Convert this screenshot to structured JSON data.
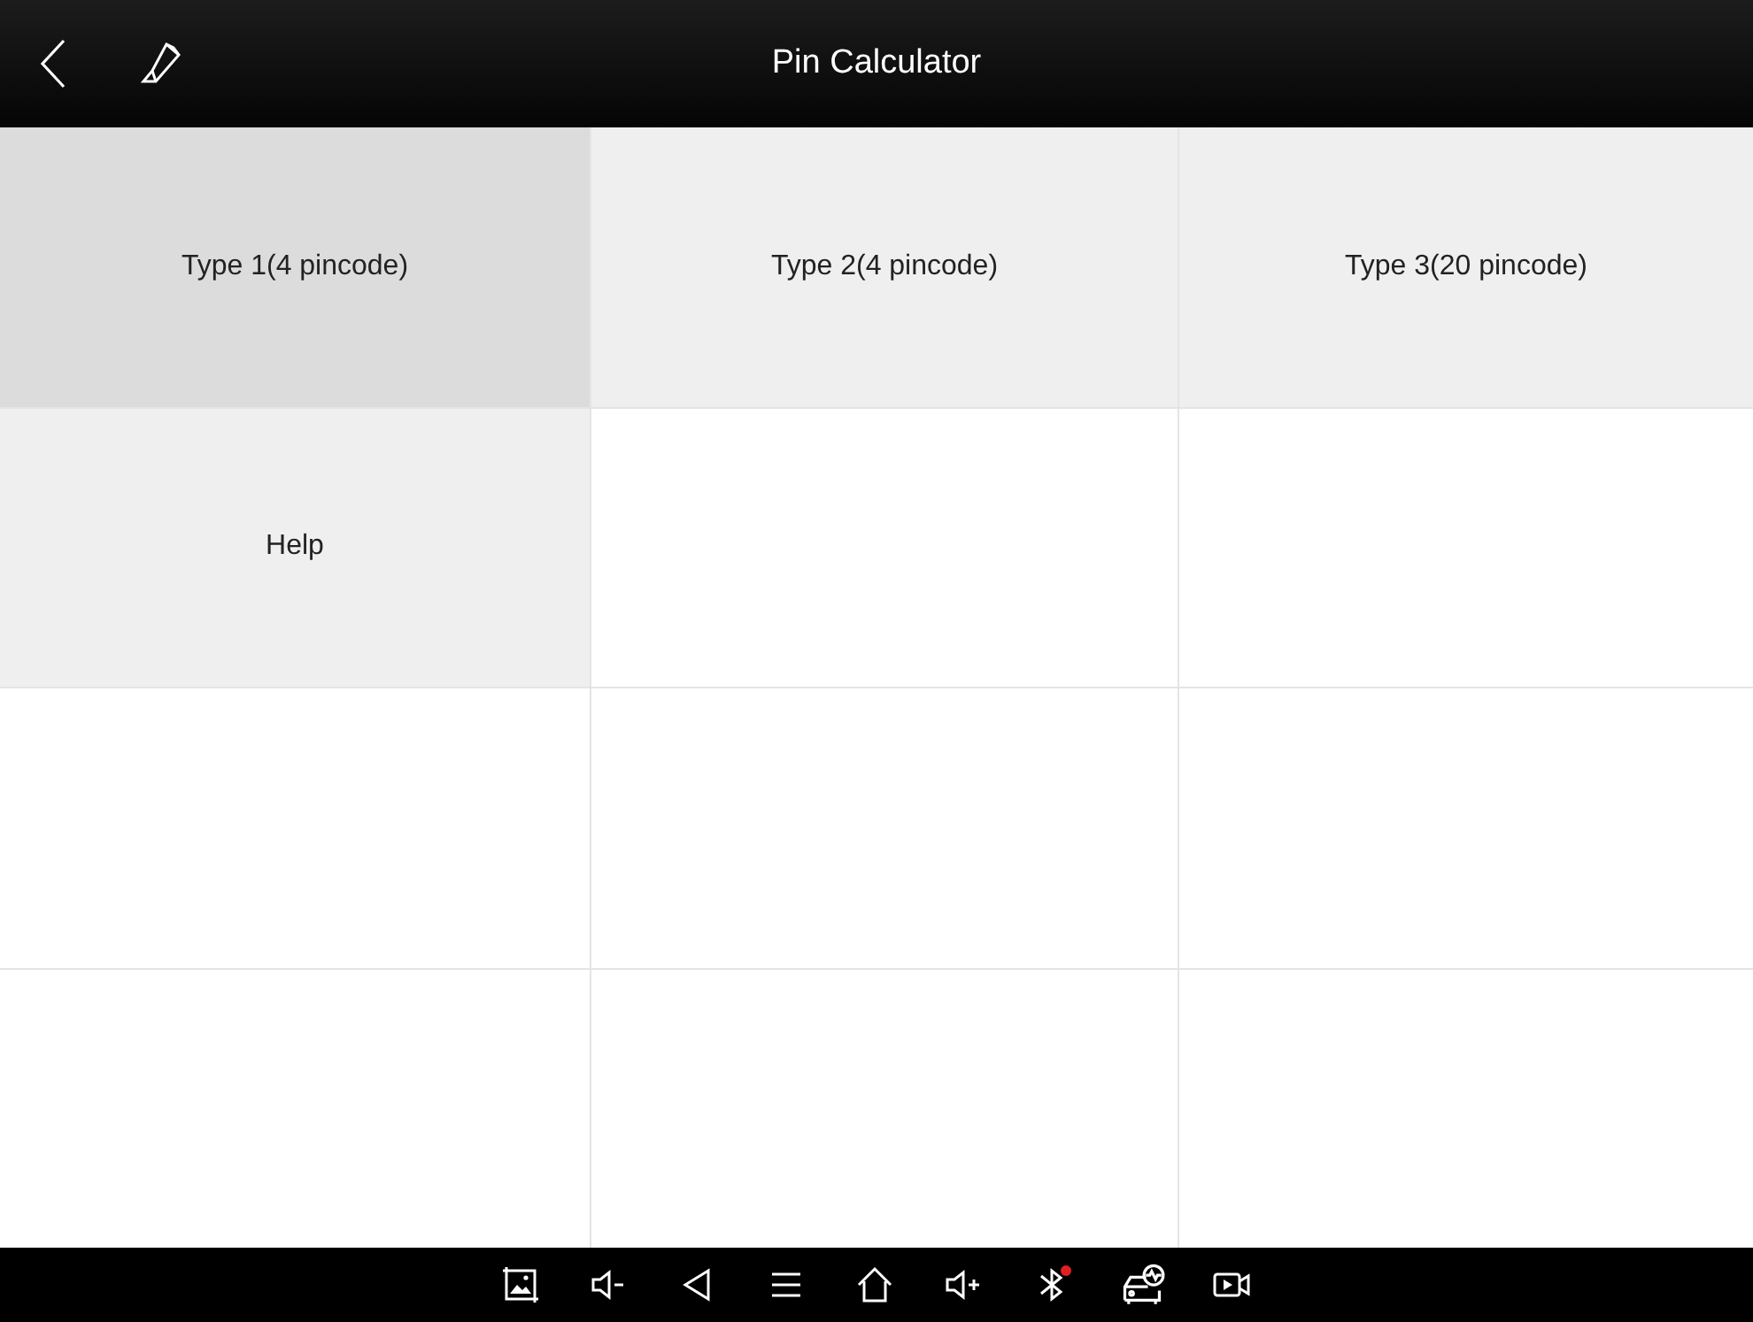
{
  "top_bar": {
    "title": "Pin Calculator"
  },
  "tiles": [
    {
      "label": "Type 1(4 pincode)",
      "selected": true
    },
    {
      "label": "Type 2(4 pincode)",
      "selected": false
    },
    {
      "label": "Type 3(20 pincode)",
      "selected": false
    },
    {
      "label": "Help",
      "selected": false
    }
  ]
}
